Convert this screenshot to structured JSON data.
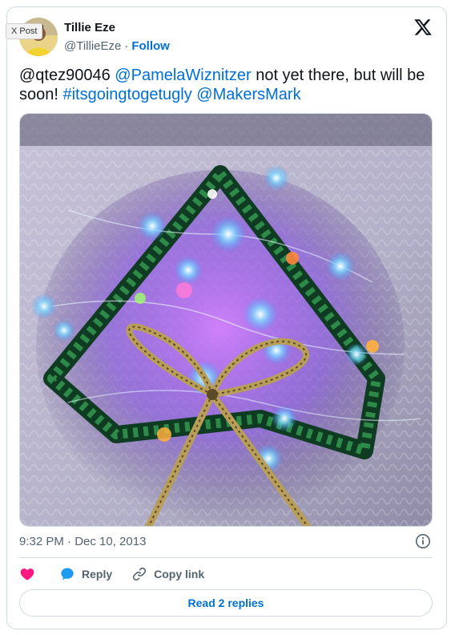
{
  "tag": {
    "label": "X Post"
  },
  "author": {
    "name": "Tillie Eze",
    "handle": "@TillieEze",
    "separator": "·",
    "follow_label": "Follow",
    "avatar_icon": "avatar-photo"
  },
  "brand": {
    "logo_icon": "x-logo-icon"
  },
  "tweet": {
    "segments": [
      {
        "text": "@qtez90046",
        "kind": "plain"
      },
      {
        "text": " ",
        "kind": "plain"
      },
      {
        "text": "@PamelaWiznitzer",
        "kind": "link"
      },
      {
        "text": " not yet there, but will be soon! ",
        "kind": "plain"
      },
      {
        "text": "#itsgoingtogetugly",
        "kind": "link"
      },
      {
        "text": " ",
        "kind": "plain"
      },
      {
        "text": "@MakersMark",
        "kind": "link"
      }
    ]
  },
  "media": {
    "alt_icon": "photo-sequin-tree-with-lights"
  },
  "meta": {
    "timestamp": "9:32 PM · Dec 10, 2013",
    "info_icon": "info-icon"
  },
  "actions": {
    "like_icon": "heart-icon",
    "reply_label": "Reply",
    "reply_icon": "reply-bubble-icon",
    "copy_label": "Copy link",
    "copy_icon": "link-icon"
  },
  "footer": {
    "read_replies_label": "Read 2 replies"
  },
  "colors": {
    "link": "#006fd6",
    "secondary_text": "#536471",
    "border": "#cfd9de",
    "heart": "#f91880",
    "reply": "#1d9bf0"
  }
}
